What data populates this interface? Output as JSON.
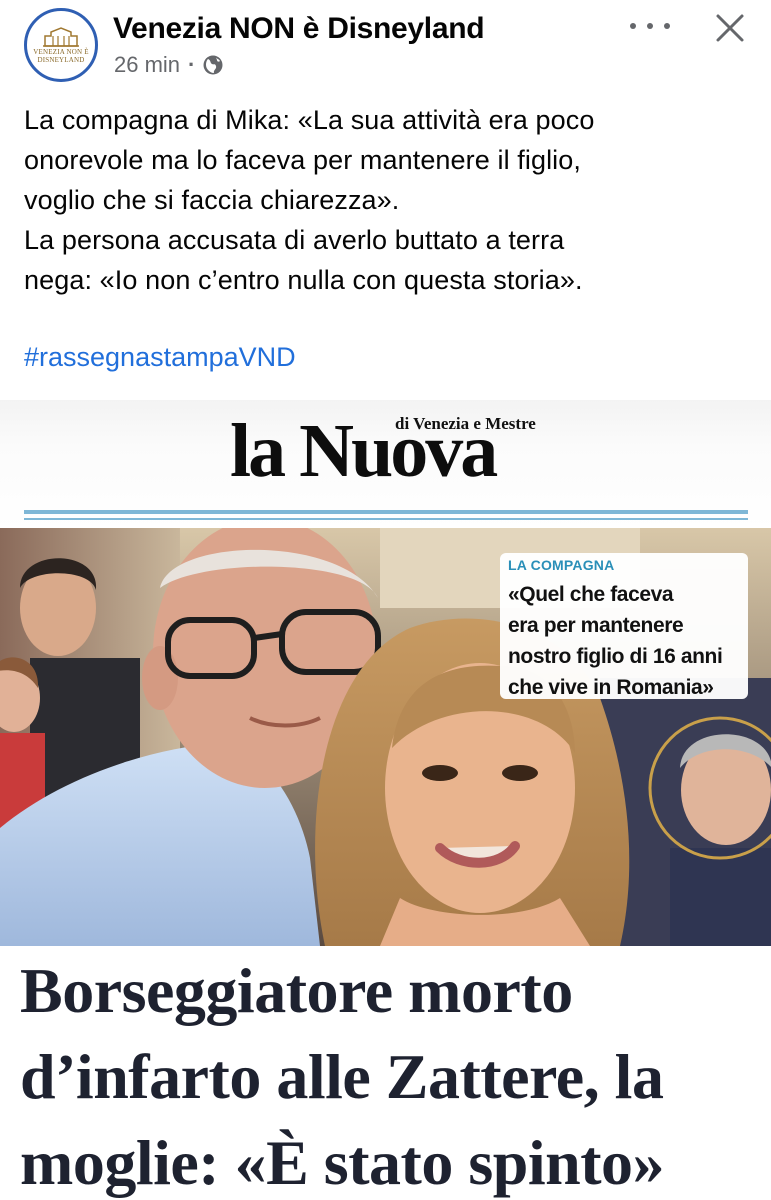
{
  "header": {
    "page_name": "Venezia NON è Disneyland",
    "timestamp": "26 min",
    "separator": "·",
    "avatar_text_1": "VENEZIA NON È",
    "avatar_text_2": "DISNEYLAND",
    "avatar_icon": "venice-building-logo",
    "audience_icon": "globe-icon",
    "more_icon": "more-dots-icon",
    "close_icon": "close-icon"
  },
  "post": {
    "lines": [
      "La compagna di Mika: «La sua attività era poco",
      "onorevole ma lo faceva per mantenere il figlio,",
      "voglio che si faccia chiarezza».",
      "La persona accusata di averlo buttato a terra",
      "nega: «Io non c’entro nulla con questa storia»."
    ],
    "hashtag": "#rassegnastampaVND"
  },
  "newspaper": {
    "masthead_title": "la Nuova",
    "masthead_subtitle": "di Venezia e Mestre",
    "callout_kicker": "LA COMPAGNA",
    "callout_lines": [
      "«Quel che faceva",
      "era per mantenere",
      "nostro figlio di 16 anni",
      "che vive in Romania»"
    ],
    "headline_lines": [
      "Borseggiatore morto",
      "d’infarto alle Zattere, la",
      "moglie: «È stato spinto»"
    ]
  },
  "colors": {
    "hashtag": "#216fdb",
    "meta_gray": "#65676b",
    "avatar_ring": "#2f5fb3",
    "kicker": "#2a8fb8",
    "masthead_rule": "#7fb7d6",
    "headline": "#1e2230"
  }
}
